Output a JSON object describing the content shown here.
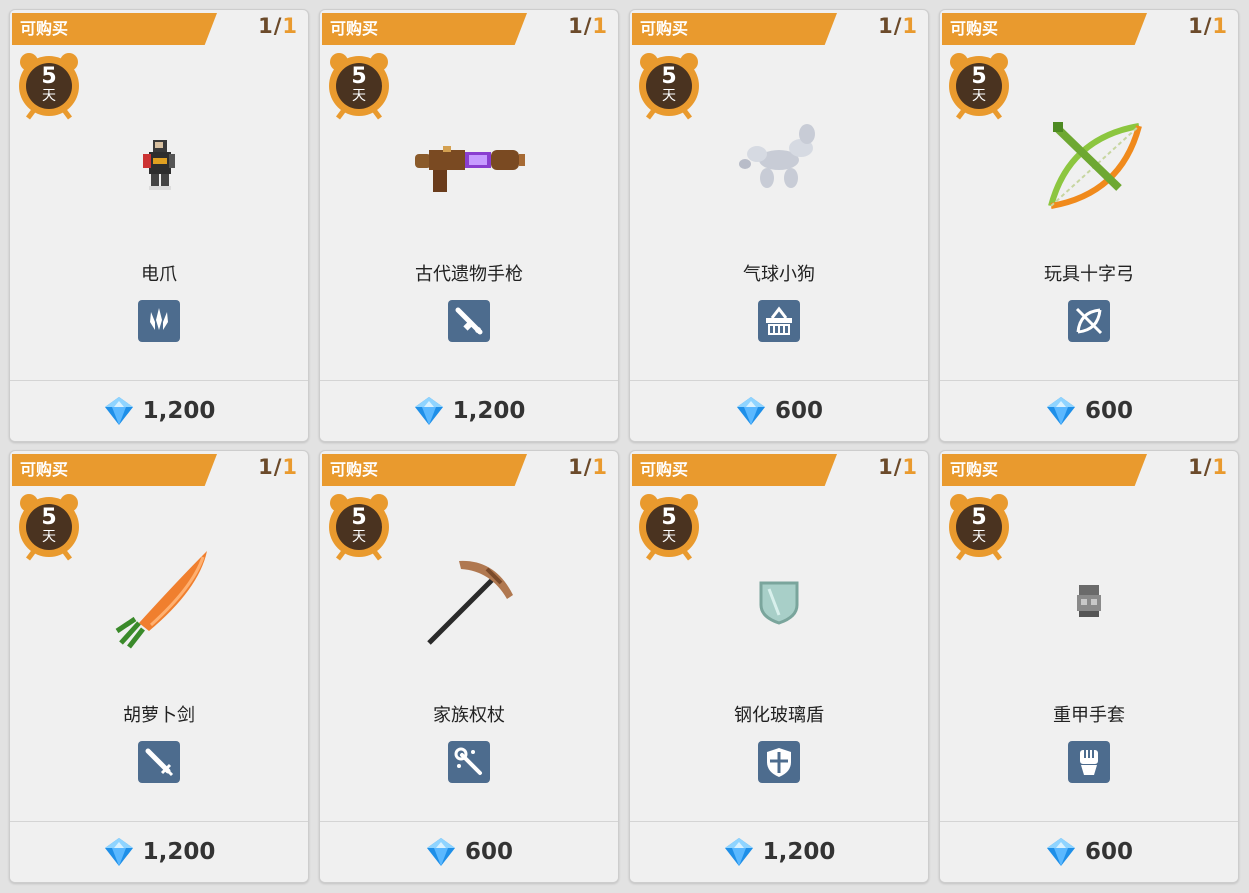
{
  "cards": [
    {
      "badge": "可购买",
      "limit_current": "1",
      "limit_sep": "/",
      "limit_max": "1",
      "days": "5",
      "days_unit": "天",
      "name": "电爪",
      "item_icon": "claw-figure",
      "type_icon": "claw-type-icon",
      "price": "1,200"
    },
    {
      "badge": "可购买",
      "limit_current": "1",
      "limit_sep": "/",
      "limit_max": "1",
      "days": "5",
      "days_unit": "天",
      "name": "古代遗物手枪",
      "item_icon": "relic-pistol",
      "type_icon": "gun-type-icon",
      "price": "1,200"
    },
    {
      "badge": "可购买",
      "limit_current": "1",
      "limit_sep": "/",
      "limit_max": "1",
      "days": "5",
      "days_unit": "天",
      "name": "气球小狗",
      "item_icon": "balloon-dog",
      "type_icon": "basket-type-icon",
      "price": "600"
    },
    {
      "badge": "可购买",
      "limit_current": "1",
      "limit_sep": "/",
      "limit_max": "1",
      "days": "5",
      "days_unit": "天",
      "name": "玩具十字弓",
      "item_icon": "toy-crossbow",
      "type_icon": "crossbow-type-icon",
      "price": "600"
    },
    {
      "badge": "可购买",
      "limit_current": "1",
      "limit_sep": "/",
      "limit_max": "1",
      "days": "5",
      "days_unit": "天",
      "name": "胡萝卜剑",
      "item_icon": "carrot-sword",
      "type_icon": "sword-type-icon",
      "price": "1,200"
    },
    {
      "badge": "可购买",
      "limit_current": "1",
      "limit_sep": "/",
      "limit_max": "1",
      "days": "5",
      "days_unit": "天",
      "name": "家族权杖",
      "item_icon": "family-pickaxe-staff",
      "type_icon": "staff-type-icon",
      "price": "600"
    },
    {
      "badge": "可购买",
      "limit_current": "1",
      "limit_sep": "/",
      "limit_max": "1",
      "days": "5",
      "days_unit": "天",
      "name": "钢化玻璃盾",
      "item_icon": "glass-shield",
      "type_icon": "shield-type-icon",
      "price": "1,200"
    },
    {
      "badge": "可购买",
      "limit_current": "1",
      "limit_sep": "/",
      "limit_max": "1",
      "days": "5",
      "days_unit": "天",
      "name": "重甲手套",
      "item_icon": "heavy-gauntlet",
      "type_icon": "fist-type-icon",
      "price": "600"
    }
  ],
  "colors": {
    "ribbon": "#e99a2e",
    "type_icon_bg": "#4d6c8e",
    "gem": "#1e8fe8",
    "limit_max": "#e99a2e",
    "limit_current": "#6b4a2a"
  },
  "currency_icon": "diamond-gem-icon",
  "timer_icon": "alarm-clock-icon"
}
